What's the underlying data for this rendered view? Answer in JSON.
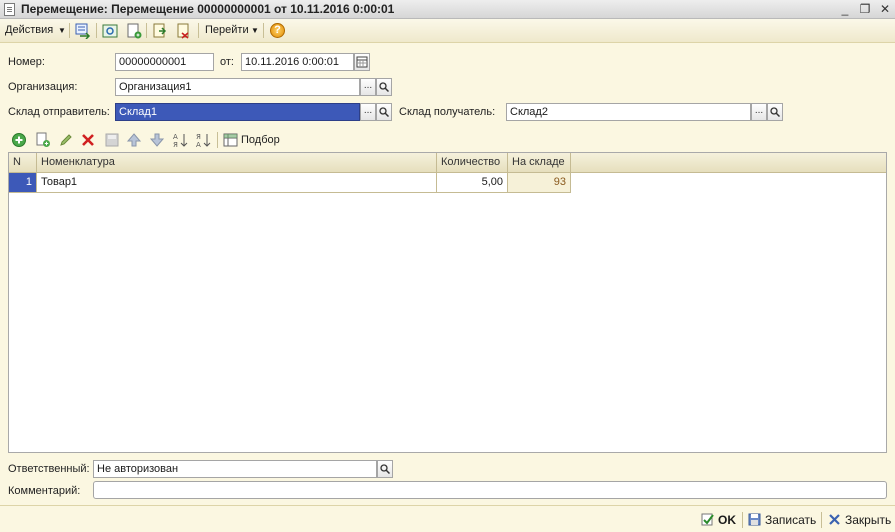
{
  "window": {
    "title": "Перемещение: Перемещение 00000000001 от 10.11.2016 0:00:01",
    "controls": [
      "_",
      "❐",
      "✕"
    ]
  },
  "toolbar": {
    "actions_label": "Действия",
    "goto_label": "Перейти",
    "help_label": "?"
  },
  "form": {
    "number_label": "Номер:",
    "number_value": "00000000001",
    "date_label": "от:",
    "date_value": "10.11.2016  0:00:01",
    "org_label": "Организация:",
    "org_value": "Организация1",
    "src_label": "Склад отправитель:",
    "src_value": "Склад1",
    "dst_label": "Склад получатель:",
    "dst_value": "Склад2",
    "choose_symbol": "...",
    "search_symbol": "🔍"
  },
  "table_toolbar": {
    "selection_label": "Подбор"
  },
  "table": {
    "columns": [
      "N",
      "Номенклатура",
      "Количество",
      "На складе"
    ],
    "rows": [
      {
        "n": "1",
        "item": "Товар1",
        "qty": "5,00",
        "stock": "93"
      }
    ]
  },
  "bottom": {
    "responsible_label": "Ответственный:",
    "responsible_value": "Не авторизован",
    "comment_label": "Комментарий:",
    "comment_value": ""
  },
  "footer": {
    "ok_label": "OK",
    "save_label": "Записать",
    "close_label": "Закрыть"
  },
  "colors": {
    "background": "#fbf7e1",
    "selection": "#3d59b8",
    "stock_value": "#8a5a1e"
  }
}
